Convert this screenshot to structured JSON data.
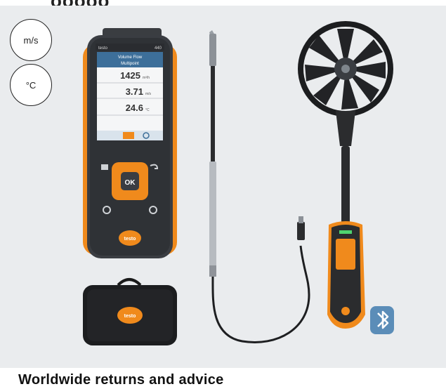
{
  "heading_fragment": "ooooo",
  "badges": {
    "velocity_unit": "m/s",
    "temperature_unit": "°C"
  },
  "meter": {
    "brand_left": "testo",
    "model_right": "440",
    "screen_title_line1": "Volume Flow",
    "screen_title_line2": "Multipoint",
    "reading_flow": "1425",
    "reading_flow_unit": "m³/h",
    "reading_velocity": "3.71",
    "reading_velocity_unit": "m/s",
    "reading_temp": "24.6",
    "reading_temp_unit": "°C",
    "ok_label": "OK",
    "logo": "testo"
  },
  "case_logo": "testo",
  "caption": "Worldwide returns and advice"
}
